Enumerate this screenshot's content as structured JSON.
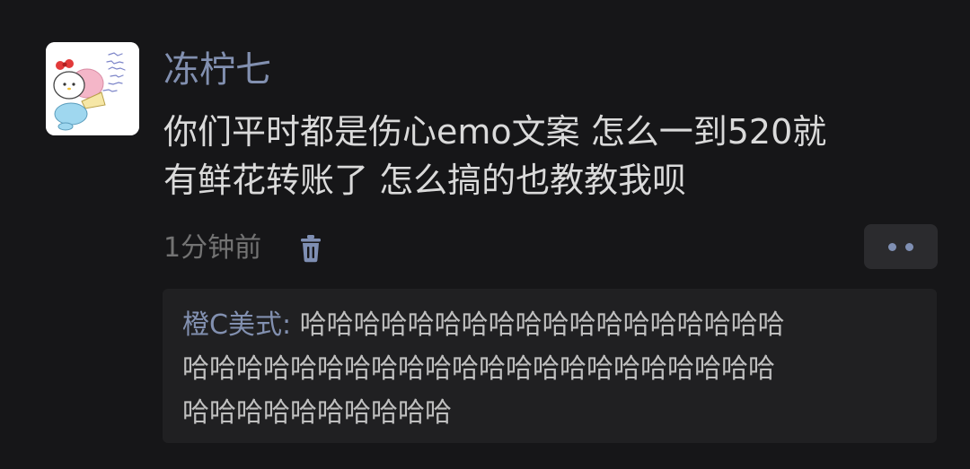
{
  "post": {
    "username": "冻柠七",
    "text_lines": [
      "你们平时都是伤心emo文案 怎么一到520就",
      "有鲜花转账了  怎么搞的也教教我呗"
    ],
    "timestamp": "1分钟前",
    "icons": {
      "delete": "trash-icon",
      "more": "more-dots-icon"
    }
  },
  "comment": {
    "author": "橙C美式",
    "separator": ": ",
    "text_line1": "哈哈哈哈哈哈哈哈哈哈哈哈哈哈哈哈哈哈",
    "text_line2": "哈哈哈哈哈哈哈哈哈哈哈哈哈哈哈哈哈哈哈哈哈哈",
    "text_line3": "哈哈哈哈哈哈哈哈哈哈"
  },
  "colors": {
    "background": "#161618",
    "name_link": "#8290b0",
    "body_text": "#dadada",
    "muted_text": "#737373",
    "comment_bg": "#202022"
  }
}
